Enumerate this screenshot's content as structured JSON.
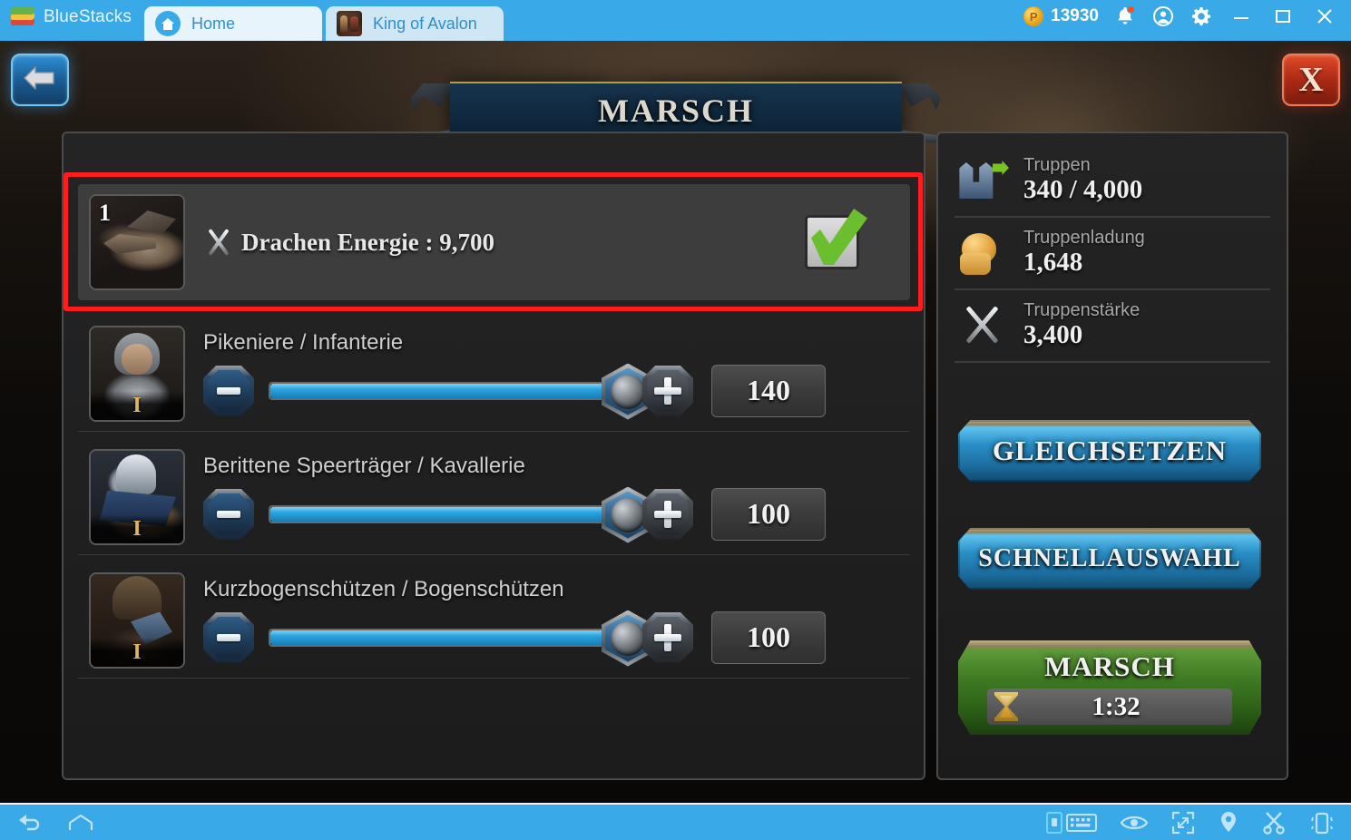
{
  "emulator": {
    "brand": "BlueStacks",
    "tabs": [
      {
        "label": "Home",
        "icon": "home-icon",
        "active": true
      },
      {
        "label": "King of Avalon",
        "icon": "game-icon",
        "active": false
      }
    ],
    "points": "13930",
    "coin_glyph": "P",
    "icons": [
      "bell-icon",
      "account-icon",
      "gear-icon",
      "minimize-icon",
      "maximize-icon",
      "close-icon"
    ],
    "bottom_icons_left": [
      "back-icon",
      "home-icon"
    ],
    "bottom_icons_right": [
      "lock-icon",
      "keyboard-icon",
      "eye-icon",
      "fullscreen-icon",
      "location-icon",
      "scissors-icon",
      "shake-icon"
    ]
  },
  "game": {
    "title": "MARSCH",
    "back_button": "back-arrow-icon",
    "close_button": "X",
    "dragon": {
      "badge": "1",
      "icon": "crossed-swords-icon",
      "label": "Drachen Energie : 9,700",
      "checked": true,
      "highlight_color": "#ff1d1d"
    },
    "troops": [
      {
        "name": "Pikeniere / Infanterie",
        "tier": "I",
        "portrait": "infantry-portrait",
        "minus": "-",
        "plus": "+",
        "count": "140",
        "slider_percent": 100
      },
      {
        "name": "Berittene Speerträger / Kavallerie",
        "tier": "I",
        "portrait": "cavalry-portrait",
        "minus": "-",
        "plus": "+",
        "count": "100",
        "slider_percent": 100
      },
      {
        "name": "Kurzbogenschützen / Bogenschützen",
        "tier": "I",
        "portrait": "archer-portrait",
        "minus": "-",
        "plus": "+",
        "count": "100",
        "slider_percent": 100
      }
    ],
    "stats": [
      {
        "icon": "troops-icon",
        "label": "Truppen",
        "value": "340 / 4,000"
      },
      {
        "icon": "pouch-icon",
        "label": "Truppenladung",
        "value": "1,648"
      },
      {
        "icon": "crossed-swords-icon",
        "label": "Truppenstärke",
        "value": "3,400"
      }
    ],
    "actions": {
      "equalize": "GLEICHSETZEN",
      "quick_select": "SCHNELLAUSWAHL",
      "march": "MARSCH",
      "march_timer": "1:32",
      "march_timer_icon": "hourglass-icon"
    },
    "colors": {
      "accent_blue": "#29a3e0",
      "march_green": "#3d7a22",
      "highlight_red": "#ff1d1d",
      "check_green": "#6bbf2e"
    }
  }
}
